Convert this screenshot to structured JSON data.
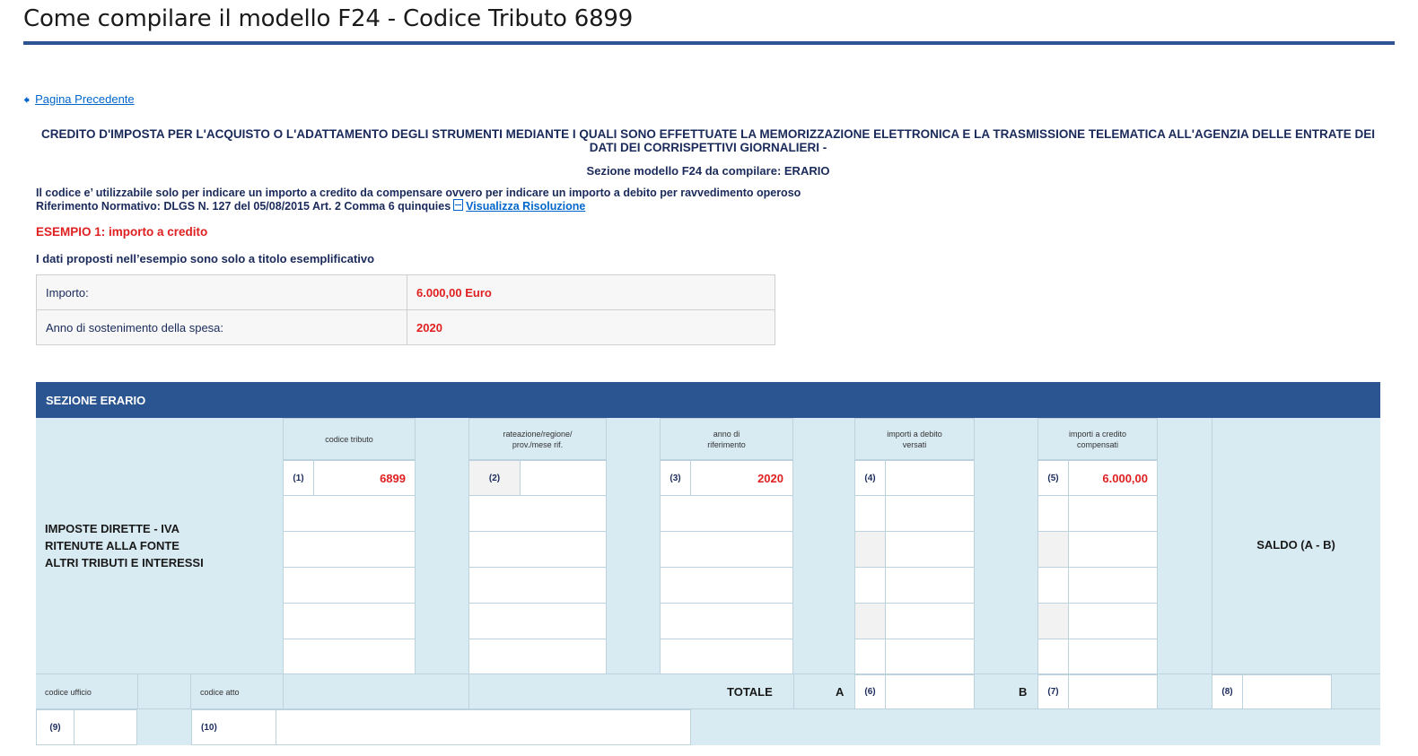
{
  "page": {
    "title": "Come compilare il modello F24 - Codice Tributo 6899",
    "back_link": "Pagina Precedente",
    "intro_title": "CREDITO D'IMPOSTA PER L'ACQUISTO O L'ADATTAMENTO DEGLI STRUMENTI MEDIANTE I QUALI SONO EFFETTUATE LA MEMORIZZAZIONE ELETTRONICA E LA TRASMISSIONE TELEMATICA ALL'AGENZIA DELLE ENTRATE DEI DATI DEI CORRISPETTIVI GIORNALIERI -",
    "section_line": "Sezione modello F24 da compilare: ERARIO",
    "desc_line1": "Il codice e’ utilizzabile solo per indicare un importo a credito da compensare ovvero per indicare un importo a debito per ravvedimento operoso",
    "desc_line2": "Riferimento Normativo: DLGS  N. 127 del 05/08/2015 Art. 2 Comma 6 quinquies",
    "resolution_link": "Visualizza Risoluzione",
    "example_label": "ESEMPIO 1: importo a credito",
    "example_note": "I dati proposti nell’esempio sono solo a titolo esemplificativo"
  },
  "info_table": [
    {
      "label": "Importo:",
      "value": "6.000,00 Euro"
    },
    {
      "label": "Anno di sostenimento della spesa:",
      "value": "2020"
    }
  ],
  "erario": {
    "header": "SEZIONE ERARIO",
    "left_label_line1": "IMPOSTE DIRETTE - IVA",
    "left_label_line2": "RITENUTE ALLA FONTE",
    "left_label_line3": "ALTRI TRIBUTI E INTERESSI",
    "col_codice": "codice tributo",
    "col_rateazione_l1": "rateazione/regione/",
    "col_rateazione_l2": "prov./mese rif.",
    "col_anno_l1": "anno di",
    "col_anno_l2": "riferimento",
    "col_debito_l1": "importi a debito",
    "col_debito_l2": "versati",
    "col_credito_l1": "importi a credito",
    "col_credito_l2": "compensati",
    "idx1": "(1)",
    "idx2": "(2)",
    "idx3": "(3)",
    "idx4": "(4)",
    "idx5": "(5)",
    "idx6": "(6)",
    "idx7": "(7)",
    "idx8": "(8)",
    "idx9": "(9)",
    "idx10": "(10)",
    "codice_value": "6899",
    "anno_value": "2020",
    "credito_value": "6.000,00",
    "saldo": "SALDO (A - B)",
    "codice_ufficio": "codice ufficio",
    "codice_atto": "codice atto",
    "totale": "TOTALE",
    "a": "A",
    "b": "B"
  },
  "colors": {
    "accent": "#2a5591",
    "highlight": "#e02020",
    "panel": "#d8eaf2",
    "link": "#0066cc"
  }
}
